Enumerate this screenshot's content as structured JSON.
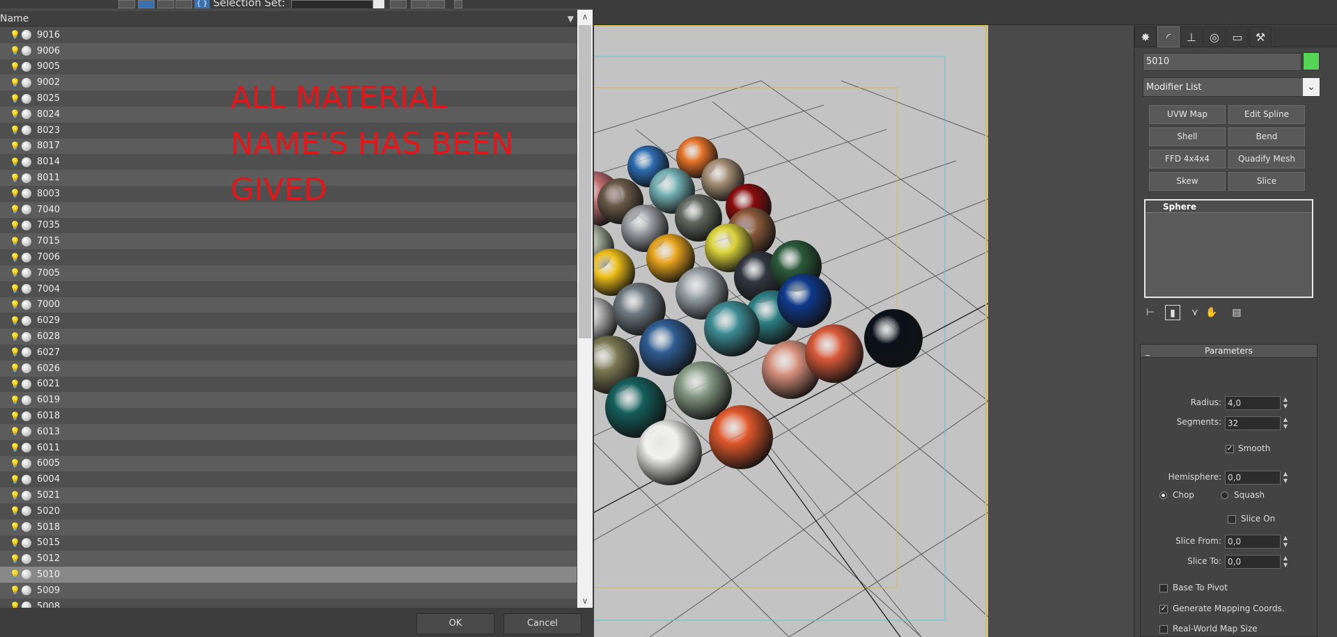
{
  "toolbar": {
    "selection_set_label": "Selection Set:",
    "selection_set_value": ""
  },
  "dialog": {
    "column_header": "Name",
    "items": [
      "9016",
      "9006",
      "9005",
      "9002",
      "8025",
      "8024",
      "8023",
      "8017",
      "8014",
      "8011",
      "8003",
      "7040",
      "7035",
      "7015",
      "7006",
      "7005",
      "7004",
      "7000",
      "6029",
      "6028",
      "6027",
      "6026",
      "6021",
      "6019",
      "6018",
      "6013",
      "6011",
      "6005",
      "6004",
      "5021",
      "5020",
      "5018",
      "5015",
      "5012",
      "5010",
      "5009",
      "5008"
    ],
    "selected_item": "5010",
    "ok_label": "OK",
    "cancel_label": "Cancel",
    "annotation": [
      "ALL MATERIAL",
      "NAME'S HAS BEEN",
      "GIVED"
    ]
  },
  "command_panel": {
    "object_name": "5010",
    "object_color": "#55d455",
    "modifier_list_label": "Modifier List",
    "modifier_buttons": [
      "UVW Map",
      "Edit Spline",
      "Shell",
      "Bend",
      "FFD 4x4x4",
      "Quadify Mesh",
      "Skew",
      "Slice"
    ],
    "stack_item": "Sphere",
    "parameters": {
      "title": "Parameters",
      "collapse_symbol": "_",
      "radius_label": "Radius:",
      "radius_value": "4,0",
      "segments_label": "Segments:",
      "segments_value": "32",
      "smooth_label": "Smooth",
      "smooth_checked": true,
      "hemisphere_label": "Hemisphere:",
      "hemisphere_value": "0,0",
      "chop_label": "Chop",
      "squash_label": "Squash",
      "slice_on_label": "Slice On",
      "slice_from_label": "Slice From:",
      "slice_from_value": "0,0",
      "slice_to_label": "Slice To:",
      "slice_to_value": "0,0",
      "base_to_pivot_label": "Base To Pivot",
      "gen_mapping_label": "Generate Mapping Coords.",
      "gen_mapping_checked": true,
      "real_world_label": "Real-World Map Size"
    }
  },
  "spheres": [
    {
      "color": "#c46f72"
    },
    {
      "color": "#2c6cb0"
    },
    {
      "color": "#e6742a"
    },
    {
      "color": "#6a5b48"
    },
    {
      "color": "#76b3b6"
    },
    {
      "color": "#a89178"
    },
    {
      "color": "#8a0c0c"
    },
    {
      "color": "#aeb8a4"
    },
    {
      "color": "#9fa1a6"
    },
    {
      "color": "#62685f"
    },
    {
      "color": "#8c5a3a"
    },
    {
      "color": "#efc01a"
    },
    {
      "color": "#e9a51d"
    },
    {
      "color": "#dcd53c"
    },
    {
      "color": "#323640"
    },
    {
      "color": "#2b5a3b"
    },
    {
      "color": "#b7b7b7"
    },
    {
      "color": "#6f7a82"
    },
    {
      "color": "#9ba3a7"
    },
    {
      "color": "#2c7f83"
    },
    {
      "color": "#0e3a8c"
    },
    {
      "color": "#7c7a54"
    },
    {
      "color": "#2f5d92"
    },
    {
      "color": "#3c8c94"
    },
    {
      "color": "#d68f7b"
    },
    {
      "color": "#d85a3a"
    },
    {
      "color": "#0b111a"
    },
    {
      "color": "#145f5c"
    },
    {
      "color": "#879c86"
    },
    {
      "color": "#f1f1ef"
    },
    {
      "color": "#e0582b"
    }
  ]
}
